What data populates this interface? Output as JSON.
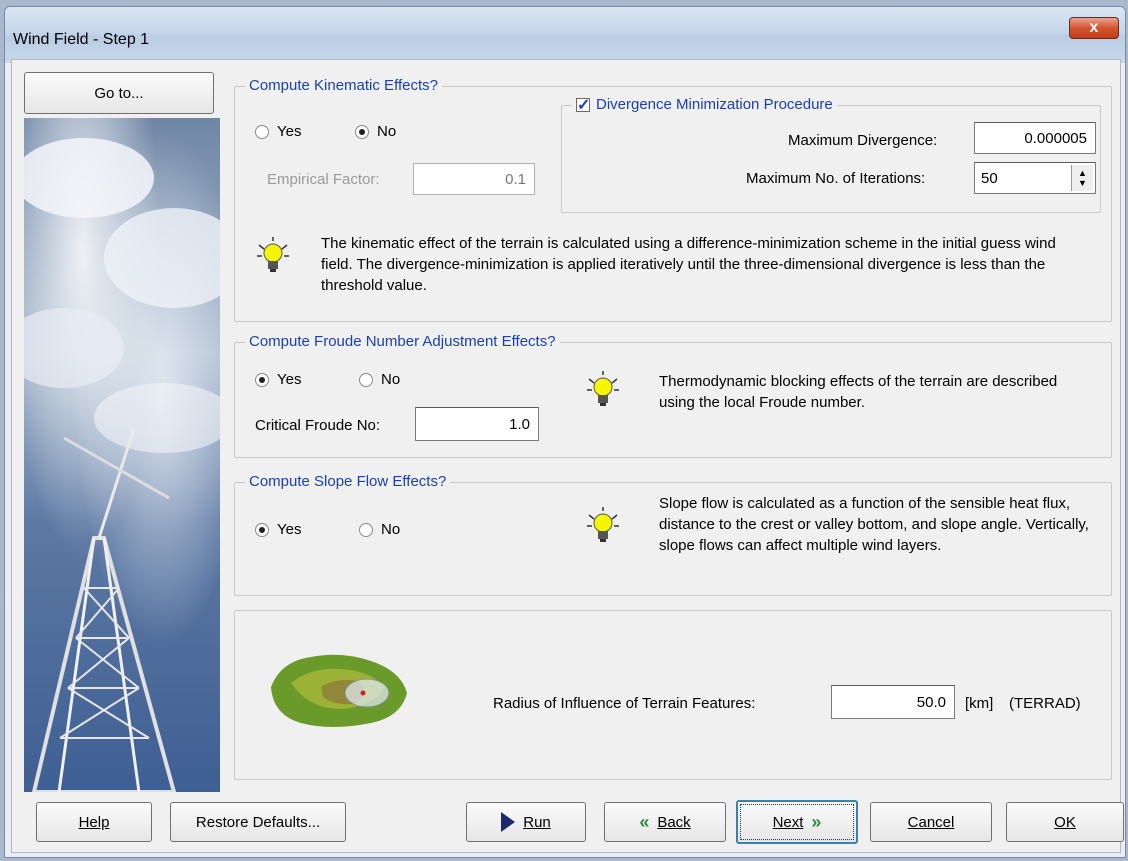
{
  "window": {
    "title": "Wind Field - Step 1",
    "close_glyph": "x"
  },
  "sidebar": {
    "goto_label": "Go to..."
  },
  "kinematic": {
    "title": "Compute Kinematic Effects?",
    "yes_label": "Yes",
    "no_label": "No",
    "selected": "No",
    "empirical_label": "Empirical Factor:",
    "empirical_value": "0.1",
    "divergence": {
      "title": "Divergence Minimization Procedure",
      "checked": true,
      "max_div_label": "Maximum Divergence:",
      "max_div_value": "0.000005",
      "max_iter_label": "Maximum  No. of Iterations:",
      "max_iter_value": "50"
    },
    "note": "The kinematic effect of the terrain is calculated using a difference-minimization scheme in the initial guess wind field. The divergence-minimization is applied iteratively until the three-dimensional divergence is less than the threshold value."
  },
  "froude": {
    "title": "Compute Froude Number Adjustment Effects?",
    "yes_label": "Yes",
    "no_label": "No",
    "selected": "Yes",
    "critical_label": "Critical Froude No:",
    "critical_value": "1.0",
    "note": "Thermodynamic blocking effects of the terrain are described using the local Froude number."
  },
  "slope": {
    "title": "Compute Slope Flow Effects?",
    "yes_label": "Yes",
    "no_label": "No",
    "selected": "Yes",
    "note": "Slope flow is calculated as a function of the sensible heat flux, distance to the crest or valley bottom, and slope angle. Vertically, slope flows can affect multiple wind layers."
  },
  "terrain": {
    "radius_label": "Radius of Influence of Terrain Features:",
    "radius_value": "50.0",
    "unit": "[km]",
    "param": "(TERRAD)"
  },
  "footer": {
    "help": "Help",
    "restore": "Restore Defaults...",
    "run": "Run",
    "back": "Back",
    "next": "Next",
    "cancel": "Cancel",
    "ok": "OK"
  },
  "colors": {
    "group_title": "#1a3fb0",
    "bulb": "#f5f500",
    "arrow": "#1a2a6c",
    "green_arrow": "#2e8b3a"
  }
}
